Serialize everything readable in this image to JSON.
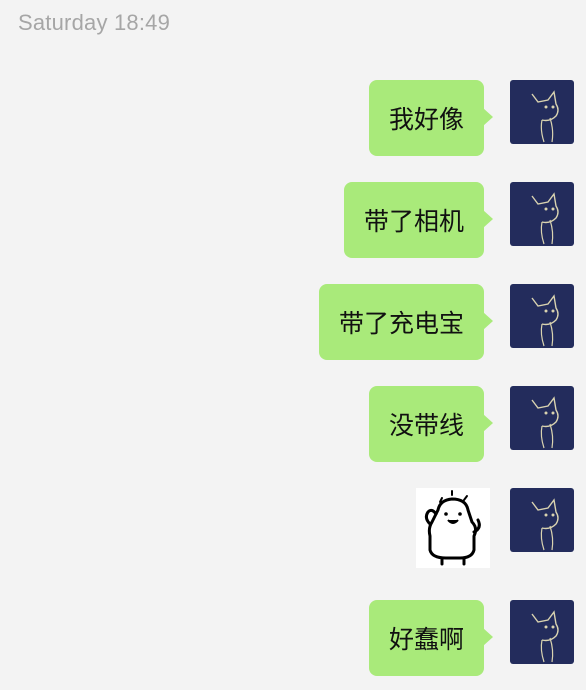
{
  "header": {
    "timestamp": "Saturday 18:49"
  },
  "messages": [
    {
      "type": "text",
      "text": "我好像"
    },
    {
      "type": "text",
      "text": "带了相机"
    },
    {
      "type": "text",
      "text": "带了充电宝"
    },
    {
      "type": "text",
      "text": "没带线"
    },
    {
      "type": "sticker",
      "icon": "cartoon-creature-sticker"
    },
    {
      "type": "text",
      "text": "好蠢啊"
    }
  ],
  "colors": {
    "background": "#f3f3f3",
    "bubble": "#a9ea7a",
    "timestamp": "#a6a6a6",
    "avatar": "#232c5c"
  }
}
